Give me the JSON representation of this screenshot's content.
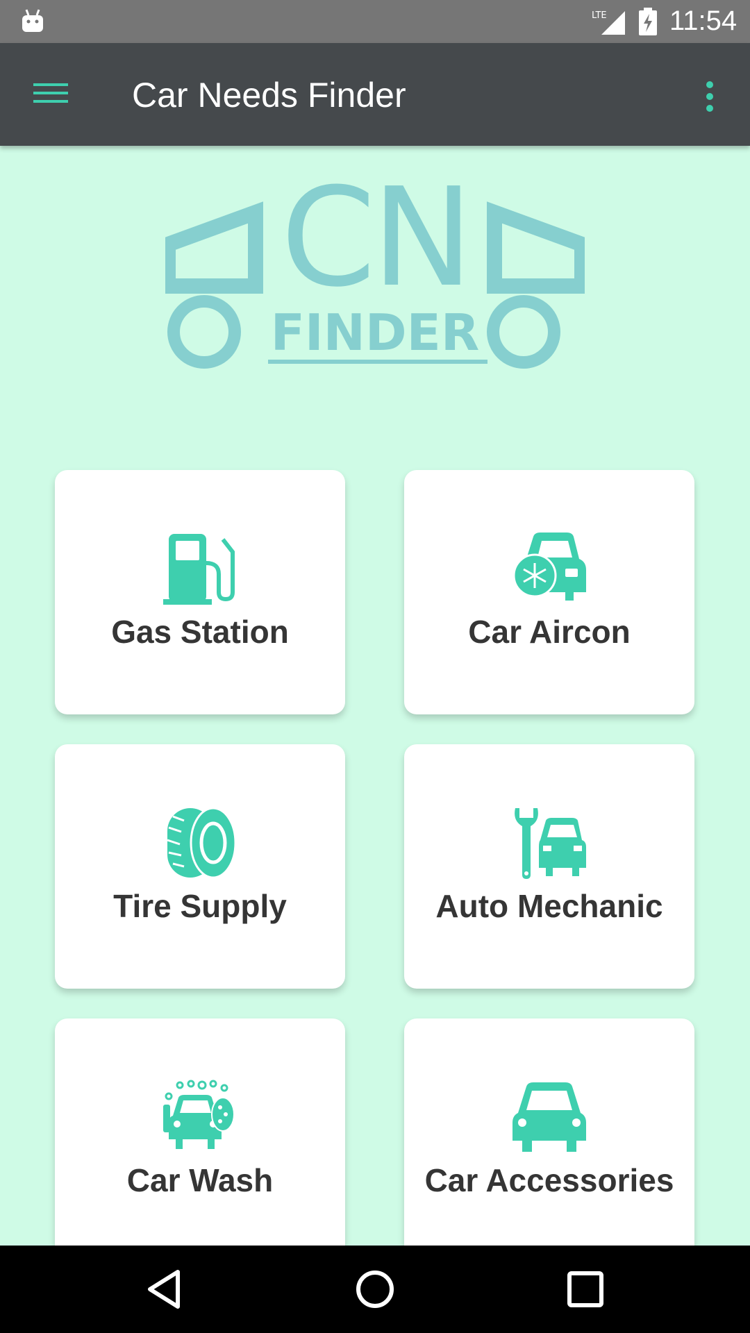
{
  "status_bar": {
    "time": "11:54",
    "network": "LTE",
    "icons": [
      "android-icon",
      "signal-icon",
      "battery-charging-icon"
    ]
  },
  "app_bar": {
    "title": "Car Needs Finder",
    "menu_icon": "hamburger-menu-icon",
    "overflow_icon": "more-vert-icon"
  },
  "logo": {
    "letters": "CN",
    "word": "FINDER",
    "color": "#86cfcf"
  },
  "categories": [
    {
      "label": "Gas Station",
      "icon": "gas-pump-icon"
    },
    {
      "label": "Car Aircon",
      "icon": "car-snowflake-icon"
    },
    {
      "label": "Tire Supply",
      "icon": "tire-icon"
    },
    {
      "label": "Auto Mechanic",
      "icon": "wrench-car-icon"
    },
    {
      "label": "Car Wash",
      "icon": "car-wash-icon"
    },
    {
      "label": "Car Accessories",
      "icon": "car-icon"
    }
  ],
  "colors": {
    "accent": "#3ecfae",
    "background": "#cffbe6",
    "app_bar": "#45494c",
    "status_bar": "#767676",
    "label_text": "#353535"
  },
  "nav_bar": {
    "buttons": [
      "back-icon",
      "home-icon",
      "recents-icon"
    ]
  }
}
